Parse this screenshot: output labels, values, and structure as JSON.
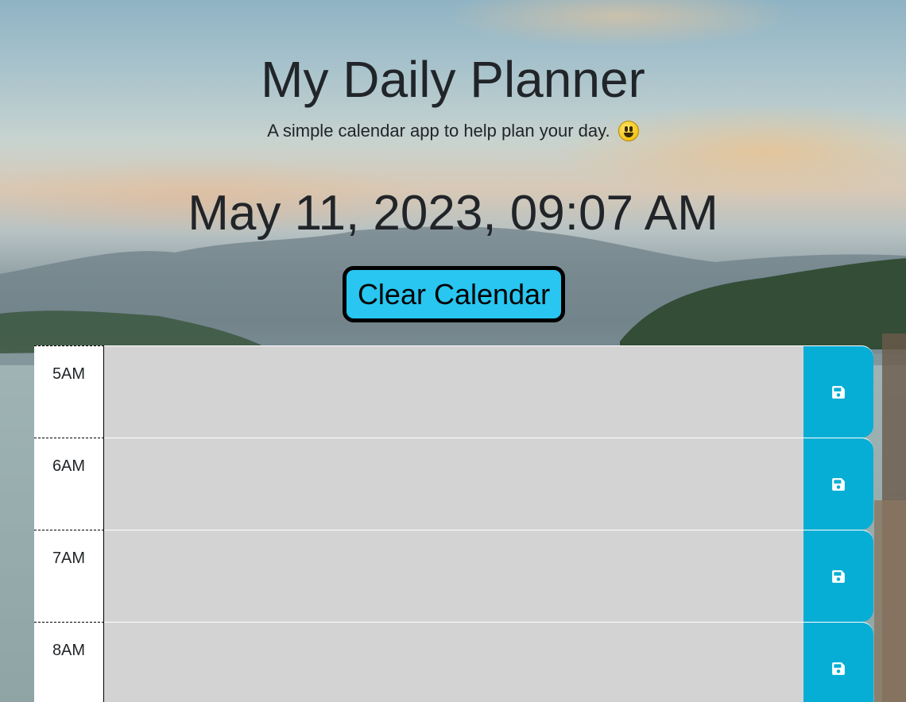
{
  "header": {
    "title": "My Daily Planner",
    "lead": "A simple calendar app to help plan your day."
  },
  "current_day": "May 11, 2023, 09:07 AM",
  "clear_button_label": "Clear Calendar",
  "time_blocks": [
    {
      "hour": "5AM",
      "text": ""
    },
    {
      "hour": "6AM",
      "text": ""
    },
    {
      "hour": "7AM",
      "text": ""
    },
    {
      "hour": "8AM",
      "text": ""
    }
  ],
  "icons": {
    "save": "save-icon",
    "emoji": "smiley-emoji-icon"
  },
  "colors": {
    "clear_button": "#28c6f0",
    "save_button": "#06aed5",
    "past_block": "#d3d3d3"
  }
}
